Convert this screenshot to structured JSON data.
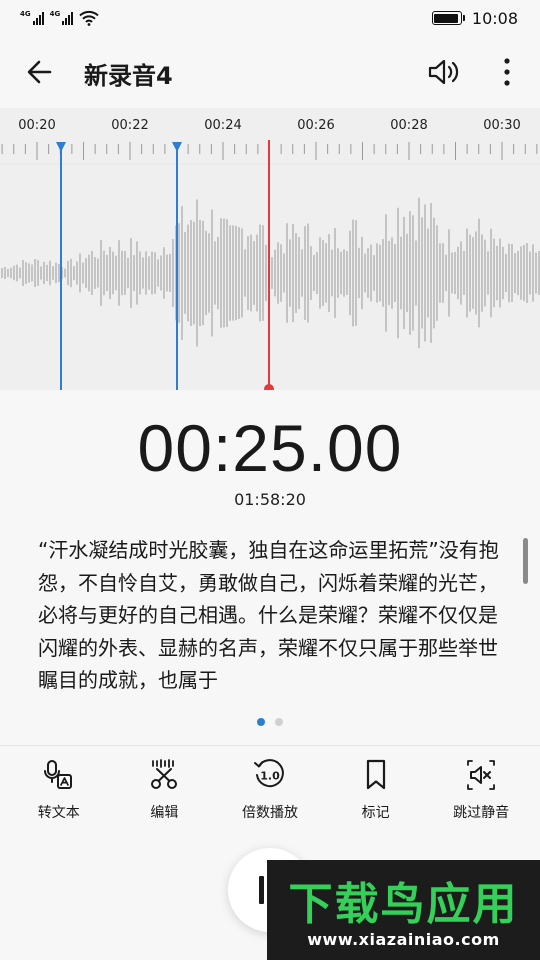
{
  "status_bar": {
    "signal_1_tag": "4G",
    "signal_2_tag": "4G",
    "wifi_icon": "wifi-icon",
    "battery_icon": "battery-icon",
    "battery_level": 0.95,
    "time": "10:08"
  },
  "header": {
    "back_icon": "arrow-left-icon",
    "title": "新录音4",
    "speaker_icon": "speaker-icon",
    "more_icon": "more-vertical-icon"
  },
  "waveform": {
    "tick_labels": [
      "00:20",
      "00:22",
      "00:24",
      "00:26",
      "00:28",
      "00:30"
    ],
    "marker_color": "#2f7dd1",
    "playhead_color": "#e23b3b"
  },
  "player": {
    "current_time": "00:25.00",
    "total_time": "01:58:20"
  },
  "transcript": {
    "text": "“汗水凝结成时光胶囊，独自在这命运里拓荒”没有抱怨，不自怜自艾，勇敢做自己，闪烁着荣耀的光芒，必将与更好的自己相遇。什么是荣耀？荣耀不仅仅是闪耀的外表、显赫的名声，荣耀不仅只属于那些举世瞩目的成就，也属于"
  },
  "pager": {
    "active_color": "#2f7dd1",
    "inactive_color": "#d0d0d0"
  },
  "toolbar": {
    "items": [
      {
        "icon": "speech-to-text-icon",
        "label": "转文本"
      },
      {
        "icon": "scissors-icon",
        "label": "编辑"
      },
      {
        "icon": "speed-icon",
        "label": "倍数播放",
        "badge": "1.0"
      },
      {
        "icon": "bookmark-icon",
        "label": "标记"
      },
      {
        "icon": "mute-skip-icon",
        "label": "跳过静音"
      }
    ]
  },
  "fab": {
    "icon": "pause-icon"
  },
  "watermark": {
    "title": "下载鸟应用",
    "url": "www.xiazainiao.com",
    "accent": "#35d05a"
  }
}
